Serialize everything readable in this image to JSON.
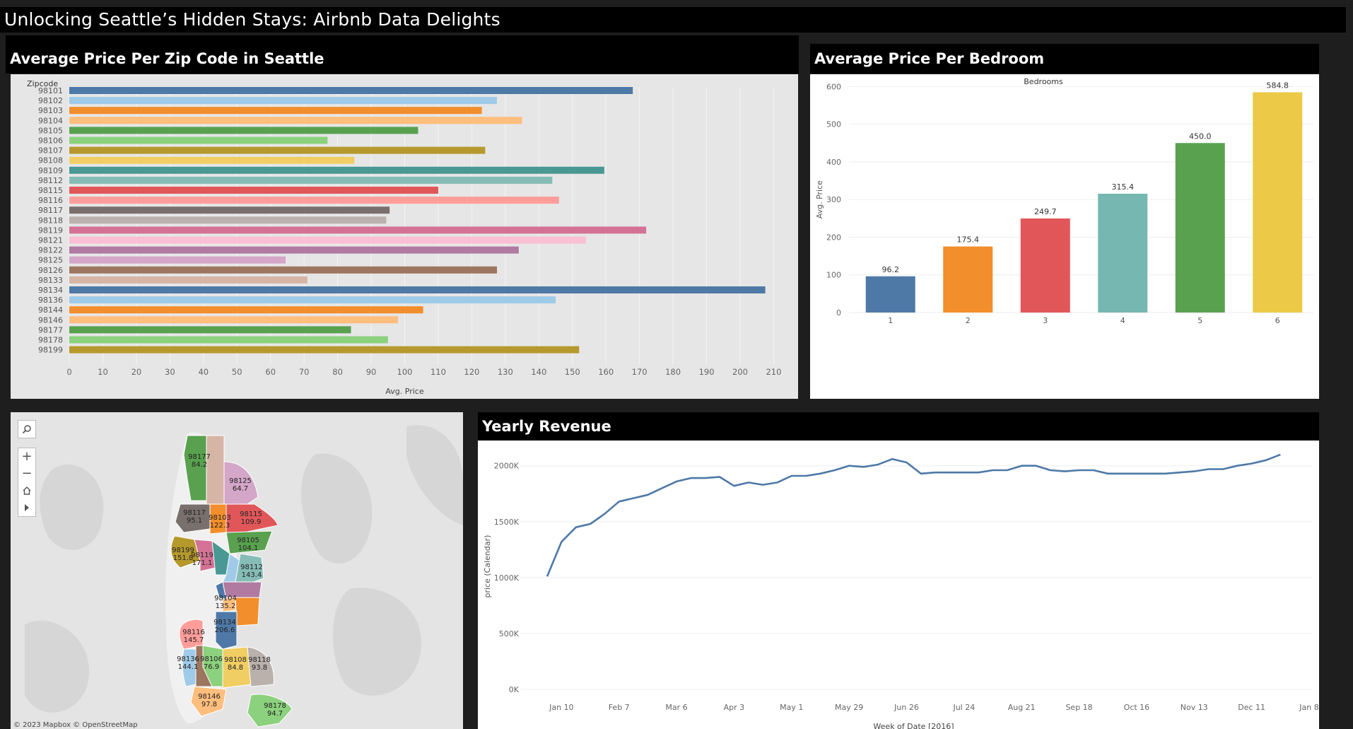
{
  "dashboard": {
    "title": "Unlocking Seattle’s Hidden Stays: Airbnb Data Delights"
  },
  "panels": {
    "zip": {
      "title": "Average Price Per Zip Code in Seattle"
    },
    "bedroom": {
      "title": "Average Price Per Bedroom"
    },
    "revenue": {
      "title": "Yearly Revenue"
    }
  },
  "chart_data": [
    {
      "type": "bar",
      "orientation": "horizontal",
      "title": "Average Price Per Zip Code in Seattle",
      "row_header": "Zipcode",
      "xlabel": "Avg. Price",
      "xlim": [
        0,
        215
      ],
      "xticks": [
        0,
        10,
        20,
        30,
        40,
        50,
        60,
        70,
        80,
        90,
        100,
        110,
        120,
        130,
        140,
        150,
        160,
        170,
        180,
        190,
        200,
        210
      ],
      "grid": true,
      "categories": [
        "98101",
        "98102",
        "98103",
        "98104",
        "98105",
        "98106",
        "98107",
        "98108",
        "98109",
        "98112",
        "98115",
        "98116",
        "98117",
        "98118",
        "98119",
        "98121",
        "98122",
        "98125",
        "98126",
        "98133",
        "98134",
        "98136",
        "98144",
        "98146",
        "98177",
        "98178",
        "98199"
      ],
      "values": [
        168.0,
        127.5,
        123.0,
        135.0,
        104.0,
        77.0,
        124.0,
        85.0,
        159.5,
        144.0,
        110.0,
        146.0,
        95.5,
        94.5,
        172.0,
        154.0,
        134.0,
        64.5,
        127.5,
        71.0,
        207.5,
        145.0,
        105.5,
        98.0,
        84.0,
        95.0,
        152.0
      ],
      "colors": [
        "#4e79a7",
        "#a0cbe8",
        "#f28e2b",
        "#ffbe7d",
        "#59a14f",
        "#8cd17d",
        "#b6992d",
        "#f1ce63",
        "#499894",
        "#86bcb6",
        "#e15759",
        "#ff9d9a",
        "#79706e",
        "#bab0ac",
        "#d37295",
        "#fabfd2",
        "#b07aa1",
        "#d4a6c8",
        "#9d7660",
        "#d7b5a6",
        "#4e79a7",
        "#a0cbe8",
        "#f28e2b",
        "#ffbe7d",
        "#59a14f",
        "#8cd17d",
        "#b6992d"
      ]
    },
    {
      "type": "bar",
      "title": "Average Price Per Bedroom",
      "column_header": "Bedrooms",
      "ylabel": "Avg. Price",
      "ylim": [
        0,
        620
      ],
      "yticks": [
        0,
        100,
        200,
        300,
        400,
        500,
        600
      ],
      "categories": [
        "1",
        "2",
        "3",
        "4",
        "5",
        "6"
      ],
      "values": [
        96.2,
        175.4,
        249.7,
        315.4,
        450.0,
        584.8
      ],
      "labels": [
        "96.2",
        "175.4",
        "249.7",
        "315.4",
        "450.0",
        "584.8"
      ],
      "colors": [
        "#4e79a7",
        "#f28e2b",
        "#e15759",
        "#76b7b2",
        "#59a14f",
        "#edc948"
      ]
    },
    {
      "type": "line",
      "title": "Yearly Revenue",
      "xlabel": "Week of Date [2016]",
      "ylabel": "price (Calendar)",
      "ylim": [
        0,
        2150000
      ],
      "yticks": [
        0,
        500000,
        1000000,
        1500000,
        2000000
      ],
      "ytick_labels": [
        "0K",
        "500K",
        "1000K",
        "1500K",
        "2000K"
      ],
      "xlim": [
        "2016-01-03",
        "2017-01-08"
      ],
      "xtick_dates": [
        "2016-01-10",
        "2016-02-07",
        "2016-03-06",
        "2016-04-03",
        "2016-05-01",
        "2016-05-29",
        "2016-06-26",
        "2016-07-24",
        "2016-08-21",
        "2016-09-18",
        "2016-10-16",
        "2016-11-13",
        "2016-12-11",
        "2017-01-08"
      ],
      "xtick_labels": [
        "Jan 10",
        "Feb 7",
        "Mar 6",
        "Apr 3",
        "May 1",
        "May 29",
        "Jun 26",
        "Jul 24",
        "Aug 21",
        "Sep 18",
        "Oct 16",
        "Nov 13",
        "Dec 11",
        "Jan 8"
      ],
      "color": "#4e79a7",
      "series": [
        {
          "x": [
            "2016-01-03",
            "2016-01-10",
            "2016-01-17",
            "2016-01-24",
            "2016-01-31",
            "2016-02-07",
            "2016-02-14",
            "2016-02-21",
            "2016-02-28",
            "2016-03-06",
            "2016-03-13",
            "2016-03-20",
            "2016-03-27",
            "2016-04-03",
            "2016-04-10",
            "2016-04-17",
            "2016-04-24",
            "2016-05-01",
            "2016-05-08",
            "2016-05-15",
            "2016-05-22",
            "2016-05-29",
            "2016-06-05",
            "2016-06-12",
            "2016-06-19",
            "2016-06-26",
            "2016-07-03",
            "2016-07-10",
            "2016-07-17",
            "2016-07-24",
            "2016-07-31",
            "2016-08-07",
            "2016-08-14",
            "2016-08-21",
            "2016-08-28",
            "2016-09-04",
            "2016-09-11",
            "2016-09-18",
            "2016-09-25",
            "2016-10-02",
            "2016-10-09",
            "2016-10-16",
            "2016-10-23",
            "2016-10-30",
            "2016-11-06",
            "2016-11-13",
            "2016-11-20",
            "2016-11-27",
            "2016-12-04",
            "2016-12-11",
            "2016-12-18",
            "2016-12-25"
          ],
          "y": [
            1010000,
            1320000,
            1450000,
            1480000,
            1570000,
            1680000,
            1710000,
            1740000,
            1800000,
            1860000,
            1890000,
            1890000,
            1900000,
            1820000,
            1850000,
            1830000,
            1850000,
            1910000,
            1910000,
            1930000,
            1960000,
            2000000,
            1990000,
            2010000,
            2060000,
            2030000,
            1930000,
            1940000,
            1940000,
            1940000,
            1940000,
            1960000,
            1960000,
            2000000,
            2000000,
            1960000,
            1950000,
            1960000,
            1960000,
            1930000,
            1930000,
            1930000,
            1930000,
            1930000,
            1940000,
            1950000,
            1970000,
            1970000,
            2000000,
            2020000,
            2050000,
            2100000
          ]
        }
      ]
    }
  ],
  "map": {
    "zoom_in": "+",
    "zoom_out": "−",
    "home_icon": "home-icon",
    "play_icon": "play-icon",
    "credit": "© 2023 Mapbox  © OpenStreetMap",
    "regions": [
      {
        "zip": "98177",
        "value": "84.2",
        "color": "#59a14f"
      },
      {
        "zip": "98133",
        "value": "",
        "color": "#d7b5a6"
      },
      {
        "zip": "98125",
        "value": "64.7",
        "color": "#d4a6c8"
      },
      {
        "zip": "98117",
        "value": "95.1",
        "color": "#79706e"
      },
      {
        "zip": "98103",
        "value": "122.3",
        "color": "#f28e2b"
      },
      {
        "zip": "98115",
        "value": "109.9",
        "color": "#e15759"
      },
      {
        "zip": "98105",
        "value": "104.1",
        "color": "#59a14f"
      },
      {
        "zip": "98199",
        "value": "151.8",
        "color": "#b6992d"
      },
      {
        "zip": "98119",
        "value": "171.1",
        "color": "#d37295"
      },
      {
        "zip": "98109",
        "value": "",
        "color": "#499894"
      },
      {
        "zip": "98102",
        "value": "",
        "color": "#a0cbe8"
      },
      {
        "zip": "98112",
        "value": "143.4",
        "color": "#86bcb6"
      },
      {
        "zip": "98122",
        "value": "",
        "color": "#b07aa1"
      },
      {
        "zip": "98104",
        "value": "135.2",
        "color": "#ffbe7d"
      },
      {
        "zip": "98101",
        "value": "",
        "color": "#4e79a7"
      },
      {
        "zip": "98144",
        "value": "",
        "color": "#f28e2b"
      },
      {
        "zip": "98116",
        "value": "145.7",
        "color": "#ff9d9a"
      },
      {
        "zip": "98134",
        "value": "206.6",
        "color": "#4e79a7"
      },
      {
        "zip": "98136",
        "value": "144.1",
        "color": "#a0cbe8"
      },
      {
        "zip": "98126",
        "value": "",
        "color": "#9d7660"
      },
      {
        "zip": "98106",
        "value": "76.9",
        "color": "#8cd17d"
      },
      {
        "zip": "98108",
        "value": "84.8",
        "color": "#f1ce63"
      },
      {
        "zip": "98118",
        "value": "93.8",
        "color": "#bab0ac"
      },
      {
        "zip": "98146",
        "value": "97.8",
        "color": "#ffbe7d"
      },
      {
        "zip": "98178",
        "value": "94.7",
        "color": "#8cd17d"
      }
    ]
  }
}
